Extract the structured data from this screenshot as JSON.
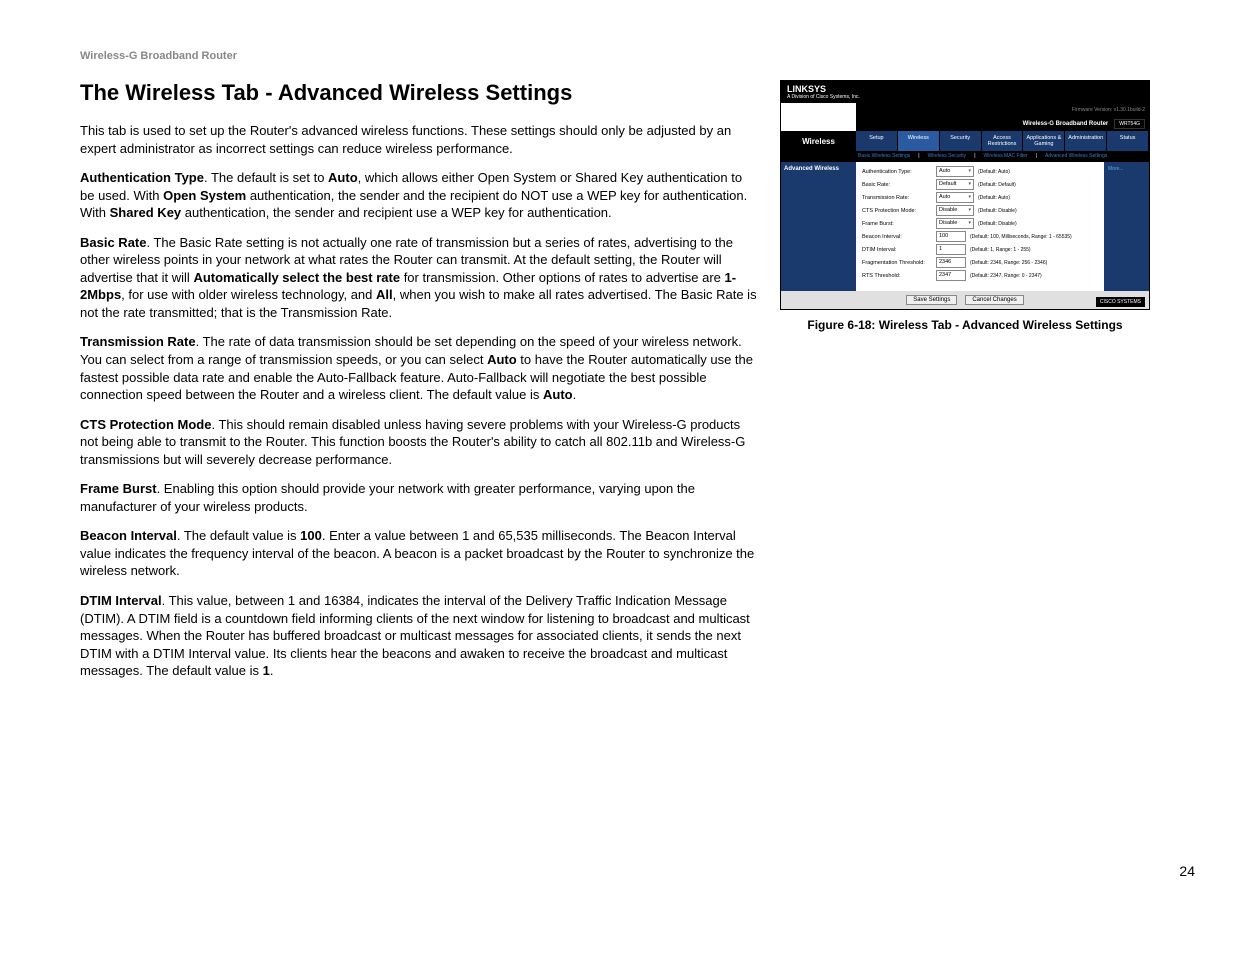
{
  "header": {
    "product": "Wireless-G Broadband Router"
  },
  "title": "The Wireless Tab - Advanced Wireless Settings",
  "paragraphs": {
    "intro": "This tab is used to set up the Router's advanced wireless functions. These settings should only be adjusted by an expert administrator as incorrect settings can reduce wireless performance.",
    "auth_label": "Authentication Type",
    "auth_text1": ". The default is set to ",
    "auth_auto": "Auto",
    "auth_text2": ", which allows either Open System or Shared Key authentication to be used. With ",
    "auth_open": "Open System",
    "auth_text3": " authentication, the sender and the recipient do NOT use a WEP key for authentication. With ",
    "auth_shared": "Shared Key",
    "auth_text4": " authentication, the sender and recipient use a WEP key for authentication.",
    "basic_label": "Basic Rate",
    "basic_text1": ". The Basic Rate setting is not actually one rate of transmission but a series of rates, advertising to the other wireless points in your network at what rates the Router can transmit. At the default setting, the Router will advertise that it will ",
    "basic_auto": "Automatically select the best rate",
    "basic_text2": " for transmission. Other options of rates to advertise are ",
    "basic_12": "1-2Mbps",
    "basic_text3": ", for use with older wireless technology, and ",
    "basic_all": "All",
    "basic_text4": ", when you wish to make all rates advertised. The Basic Rate is not the rate transmitted; that is the Transmission Rate.",
    "trans_label": "Transmission Rate",
    "trans_text1": ". The rate of data transmission should be set depending on the speed of your wireless network. You can select from a range of transmission speeds, or you can select ",
    "trans_auto1": "Auto",
    "trans_text2": " to have the Router automatically use the fastest possible data rate and enable the Auto-Fallback feature. Auto-Fallback will negotiate the best possible connection speed between the Router and a wireless client. The default value is ",
    "trans_auto2": "Auto",
    "trans_text3": ".",
    "cts_label": "CTS Protection Mode",
    "cts_text": ". This should remain disabled unless having severe problems with your Wireless-G products not being able to transmit to the Router. This function boosts the Router's ability to catch all 802.11b and Wireless-G transmissions but will severely decrease performance.",
    "frame_label": "Frame Burst",
    "frame_text": ". Enabling this option should provide your network with greater performance, varying upon the manufacturer of your wireless products.",
    "beacon_label": "Beacon Interval",
    "beacon_text1": ". The default value is ",
    "beacon_100": "100",
    "beacon_text2": ". Enter a value between 1 and 65,535 milliseconds. The Beacon Interval value indicates the frequency interval of the beacon. A beacon is a packet broadcast by the Router to synchronize the wireless network.",
    "dtim_label": "DTIM Interval",
    "dtim_text1": ". This value, between 1 and 16384, indicates the interval of the Delivery Traffic Indication Message (DTIM). A DTIM field is a countdown field informing clients of the next window for listening to broadcast and multicast messages. When the Router has buffered broadcast or multicast messages for associated clients, it sends the next DTIM with a DTIM Interval value. Its clients hear the beacons and awaken to receive the broadcast and multicast messages. The default value is ",
    "dtim_1": "1",
    "dtim_text2": "."
  },
  "figure": {
    "caption": "Figure 6-18: Wireless Tab - Advanced Wireless Settings"
  },
  "router": {
    "brand": "LINKSYS",
    "tagline": "A Division of Cisco Systems, Inc.",
    "firmware": "Firmware Version: v1.30.1build-2",
    "banner": "Wireless-G Broadband Router",
    "model": "WRT54G",
    "sideTab": "Wireless",
    "tabs": [
      "Setup",
      "Wireless",
      "Security",
      "Access Restrictions",
      "Applications & Gaming",
      "Administration",
      "Status"
    ],
    "subtabs": [
      "Basic Wireless Settings",
      "Wireless Security",
      "Wireless MAC Filter",
      "Advanced Wireless Settings"
    ],
    "section": "Advanced Wireless",
    "more": "More...",
    "fields": [
      {
        "label": "Authentication Type:",
        "value": "Auto",
        "type": "select",
        "hint": "(Default: Auto)"
      },
      {
        "label": "Basic Rate:",
        "value": "Default",
        "type": "select",
        "hint": "(Default: Default)"
      },
      {
        "label": "Transmission Rate:",
        "value": "Auto",
        "type": "select",
        "hint": "(Default: Auto)"
      },
      {
        "label": "CTS Protection Mode:",
        "value": "Disable",
        "type": "select",
        "hint": "(Default: Disable)"
      },
      {
        "label": "Frame Burst:",
        "value": "Disable",
        "type": "select",
        "hint": "(Default: Disable)"
      },
      {
        "label": "Beacon Interval:",
        "value": "100",
        "type": "text",
        "hint": "(Default: 100, Milliseconds, Range: 1 - 65535)"
      },
      {
        "label": "DTIM Interval:",
        "value": "1",
        "type": "text",
        "hint": "(Default: 1, Range: 1 - 255)"
      },
      {
        "label": "Fragmentation Threshold:",
        "value": "2346",
        "type": "text",
        "hint": "(Default: 2346, Range: 256 - 2346)"
      },
      {
        "label": "RTS Threshold:",
        "value": "2347",
        "type": "text",
        "hint": "(Default: 2347, Range: 0 - 2347)"
      }
    ],
    "save": "Save Settings",
    "cancel": "Cancel Changes",
    "cisco": "CISCO SYSTEMS"
  },
  "pageNumber": "24"
}
